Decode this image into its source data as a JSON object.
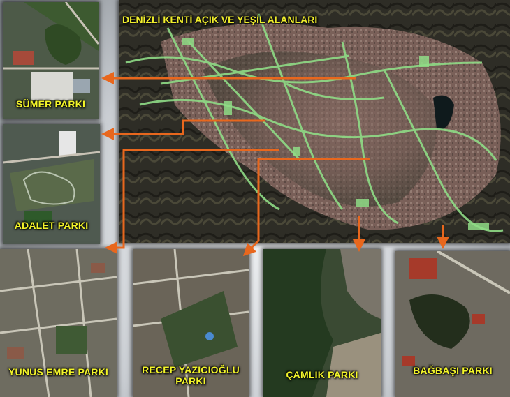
{
  "title": "DENİZLİ KENTİ AÇIK VE YEŞİL ALANLARI",
  "parks": {
    "sumer": "SÜMER PARKI",
    "adalet": "ADALET PARKI",
    "yunus": "YUNUS EMRE PARKI",
    "recep": "RECEP YAZICIOĞLU PARKI",
    "camlik": "ÇAMLIK PARKI",
    "bagbasi": "BAĞBAŞI PARKI"
  },
  "colors": {
    "label": "#f3f52a",
    "arrow": "#e8671d",
    "green_area": "#8fdc86"
  }
}
